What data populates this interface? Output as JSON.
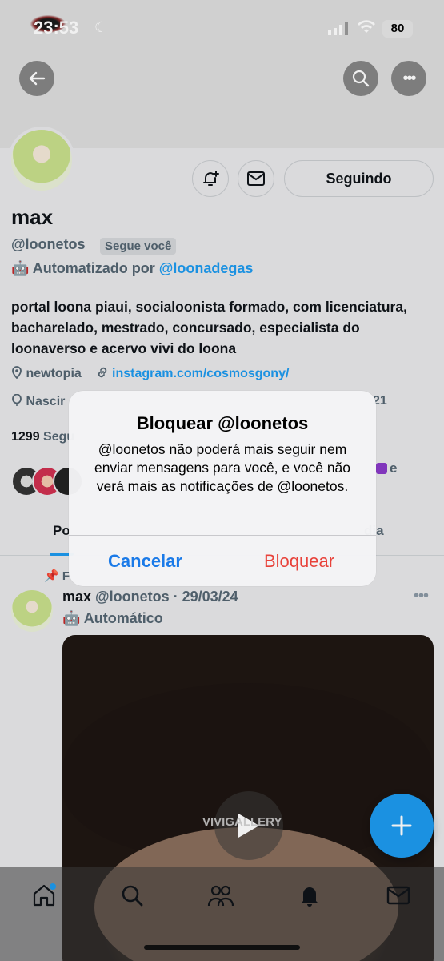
{
  "status_bar": {
    "time": "23:53",
    "battery": "80"
  },
  "profile": {
    "name": "max",
    "handle": "@loonetos",
    "follows_you_badge": "Segue você",
    "automated_prefix": "Automatizado por",
    "automated_by": "@loonadegas",
    "bio": "portal loona piaui, socialoonista formado, com licenciatura, bacharelado, mestrado, concursado, especialista do loonaverso e acervo vivi do loona",
    "location": "newtopia",
    "website": "instagram.com/cosmosgony/",
    "birth_partial": "Nascir",
    "joined_partial": "21",
    "following_count": "1299",
    "following_partial": "Segu",
    "followed_by_partial": "e",
    "follow_button": "Seguindo"
  },
  "tabs": {
    "first_partial": "Po",
    "last_partial": "dia"
  },
  "post": {
    "pinned_partial": "F",
    "author": "max",
    "handle": "@loonetos",
    "date": "29/03/24",
    "label": "Automático",
    "watermark": "VIVIGALLERY"
  },
  "dialog": {
    "title": "Bloquear @loonetos",
    "message": "@loonetos não poderá mais seguir nem enviar mensagens para você, e você não verá mais as notificações de @loonetos.",
    "cancel": "Cancelar",
    "confirm": "Bloquear"
  },
  "colors": {
    "accent": "#1d9bf0",
    "destructive": "#e8423a",
    "ios_blue": "#1a7ae8"
  },
  "icons": [
    "back-arrow-icon",
    "search-icon",
    "more-icon",
    "notification-bell-plus-icon",
    "mail-icon",
    "location-icon",
    "link-icon",
    "balloon-icon",
    "robot-icon",
    "pin-icon",
    "play-icon",
    "plus-icon",
    "home-icon",
    "people-icon",
    "bell-icon"
  ]
}
